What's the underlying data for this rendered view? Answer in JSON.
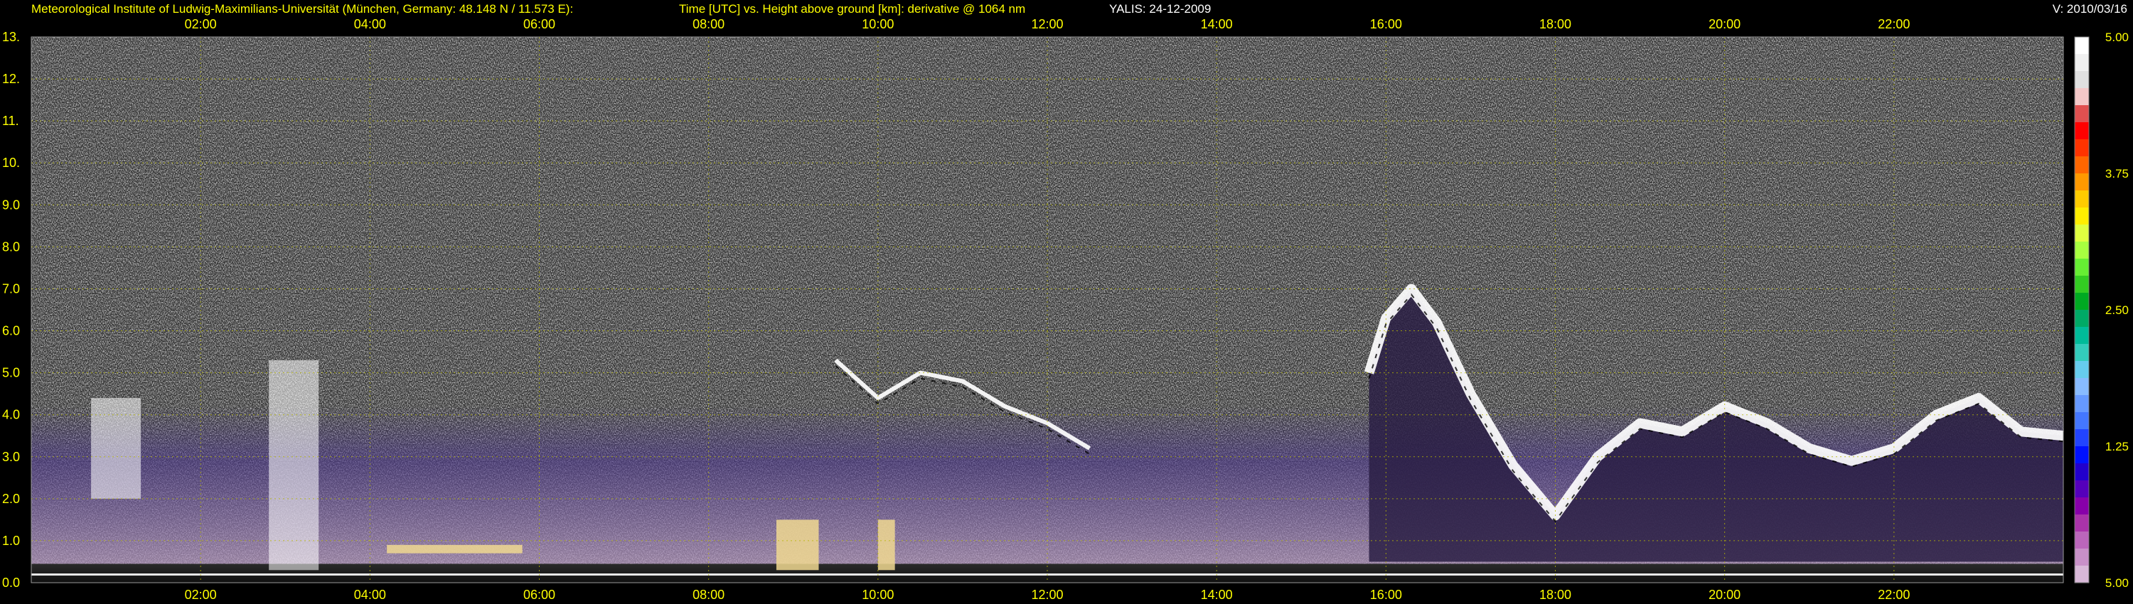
{
  "header": {
    "institute": "Meteorological Institute of Ludwig-Maximilians-Universität (München, Germany: 48.148 N / 11.573 E):",
    "plot_desc": "Time [UTC] vs. Height above ground [km]: derivative @ 1064 nm",
    "instrument_date": "YALIS: 24-12-2009",
    "version": "V: 2010/03/16"
  },
  "chart_data": {
    "type": "heatmap",
    "title": "Time [UTC] vs. Height above ground [km]: derivative @ 1064 nm",
    "xlabel": "",
    "ylabel": "",
    "x_unit": "UTC hour",
    "xlim": [
      0,
      24
    ],
    "ylim": [
      0,
      13
    ],
    "x_ticks": [
      {
        "value": 2,
        "label": "02:00"
      },
      {
        "value": 4,
        "label": "04:00"
      },
      {
        "value": 6,
        "label": "06:00"
      },
      {
        "value": 8,
        "label": "08:00"
      },
      {
        "value": 10,
        "label": "10:00"
      },
      {
        "value": 12,
        "label": "12:00"
      },
      {
        "value": 14,
        "label": "14:00"
      },
      {
        "value": 16,
        "label": "16:00"
      },
      {
        "value": 18,
        "label": "18:00"
      },
      {
        "value": 20,
        "label": "20:00"
      },
      {
        "value": 22,
        "label": "22:00"
      }
    ],
    "y_ticks": [
      {
        "value": 0,
        "label": "0.0"
      },
      {
        "value": 1,
        "label": "1.0"
      },
      {
        "value": 2,
        "label": "2.0"
      },
      {
        "value": 3,
        "label": "3.0"
      },
      {
        "value": 4,
        "label": "4.0"
      },
      {
        "value": 5,
        "label": "5.0"
      },
      {
        "value": 6,
        "label": "6.0"
      },
      {
        "value": 7,
        "label": "7.0"
      },
      {
        "value": 8,
        "label": "8.0"
      },
      {
        "value": 9,
        "label": "9.0"
      },
      {
        "value": 10,
        "label": "10."
      },
      {
        "value": 11,
        "label": "11."
      },
      {
        "value": 12,
        "label": "12."
      },
      {
        "value": 13,
        "label": "13."
      }
    ],
    "grid": true,
    "grid_color": "#b8b800",
    "colorbar": {
      "ticks": [
        "5.00",
        "3.75",
        "2.50",
        "1.25",
        "5.00"
      ],
      "colors_top_to_bottom": [
        "#ffffff",
        "#f0f0f0",
        "#e0e0e0",
        "#f4c8c8",
        "#e05050",
        "#ff0000",
        "#ff3300",
        "#ff6600",
        "#ff9900",
        "#ffcc00",
        "#ffee00",
        "#e0ff40",
        "#a8ff40",
        "#66ee33",
        "#33cc22",
        "#00aa22",
        "#00aa66",
        "#00bb99",
        "#33ccbb",
        "#66ccee",
        "#88bbff",
        "#6699ff",
        "#4477ff",
        "#2244ff",
        "#0011ff",
        "#2200cc",
        "#5500bb",
        "#8800aa",
        "#aa33aa",
        "#bb66bb",
        "#c890c8",
        "#d8b8d8"
      ]
    },
    "features": [
      {
        "kind": "boundary_layer",
        "x_start": 0,
        "x_end": 24,
        "y_start": 0.0,
        "y_end": 2.8,
        "color": "#6a4a9a"
      },
      {
        "kind": "cloud_layer",
        "x_start": 15.8,
        "x_end": 24,
        "height_profile": [
          [
            15.8,
            5.0
          ],
          [
            16.0,
            6.3
          ],
          [
            16.3,
            7.0
          ],
          [
            16.6,
            6.2
          ],
          [
            17.0,
            4.5
          ],
          [
            17.5,
            2.8
          ],
          [
            18.0,
            1.6
          ],
          [
            18.5,
            3.0
          ],
          [
            19.0,
            3.8
          ],
          [
            19.5,
            3.6
          ],
          [
            20.0,
            4.2
          ],
          [
            20.5,
            3.8
          ],
          [
            21.0,
            3.2
          ],
          [
            21.5,
            2.9
          ],
          [
            22.0,
            3.2
          ],
          [
            22.5,
            4.0
          ],
          [
            23.0,
            4.4
          ],
          [
            23.5,
            3.6
          ],
          [
            24,
            3.5
          ]
        ]
      },
      {
        "kind": "cloud_patches",
        "x_start": 9.5,
        "x_end": 12.8,
        "height_profile": [
          [
            9.5,
            5.3
          ],
          [
            10.0,
            4.4
          ],
          [
            10.5,
            5.0
          ],
          [
            11.0,
            4.8
          ],
          [
            11.5,
            4.2
          ],
          [
            12.0,
            3.8
          ],
          [
            12.5,
            3.2
          ]
        ]
      },
      {
        "kind": "cloud_column",
        "x": 3.1,
        "y_start": 0.3,
        "y_end": 5.3
      },
      {
        "kind": "cloud_column",
        "x": 1.0,
        "y_start": 2.0,
        "y_end": 4.4
      },
      {
        "kind": "aerosol_bright",
        "x_start": 8.8,
        "x_end": 9.3,
        "y_start": 0.3,
        "y_end": 1.5
      },
      {
        "kind": "aerosol_bright",
        "x_start": 10.0,
        "x_end": 10.2,
        "y_start": 0.3,
        "y_end": 1.5
      },
      {
        "kind": "aerosol_bright",
        "x_start": 4.2,
        "x_end": 5.8,
        "y_start": 0.7,
        "y_end": 0.9
      }
    ]
  }
}
